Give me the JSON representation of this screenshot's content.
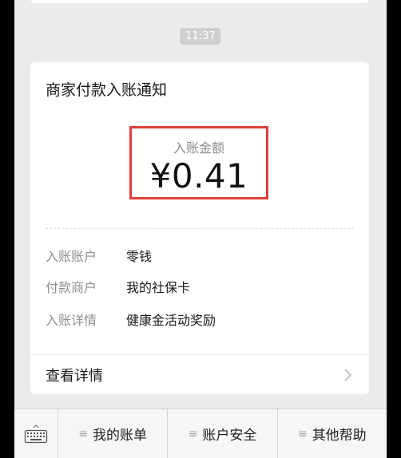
{
  "chat": {
    "timestamp": "11:37"
  },
  "card": {
    "title": "商家付款入账通知",
    "amount_label": "入账金额",
    "amount_value": "¥0.41",
    "rows": [
      {
        "key": "入账账户",
        "value": "零钱"
      },
      {
        "key": "付款商户",
        "value": "我的社保卡"
      },
      {
        "key": "入账详情",
        "value": "健康金活动奖励"
      }
    ],
    "details_label": "查看详情"
  },
  "menu": {
    "items": [
      {
        "label": "我的账单",
        "icon": "menu-lines-icon"
      },
      {
        "label": "账户安全",
        "icon": "menu-lines-icon"
      },
      {
        "label": "其他帮助",
        "icon": "menu-lines-icon"
      }
    ]
  },
  "colors": {
    "highlight": "#e23d3d",
    "background": "#ebebeb"
  }
}
